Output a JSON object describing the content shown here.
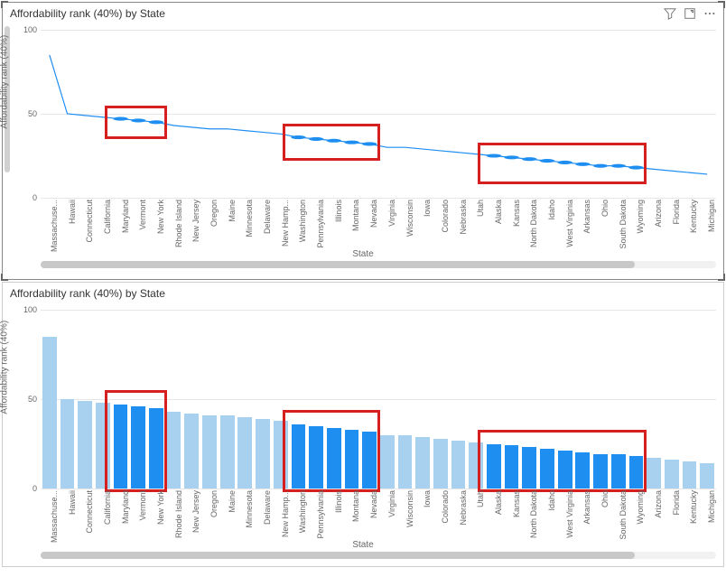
{
  "panel1": {
    "title": "Affordability rank (40%) by State",
    "ylabel": "Affordability rank (40%)",
    "xlabel": "State"
  },
  "panel2": {
    "title": "Affordability rank (40%) by State",
    "ylabel": "Affordability rank (40%)",
    "xlabel": "State"
  },
  "yticks": [
    "0",
    "50",
    "100"
  ],
  "chart_data": [
    {
      "type": "line",
      "title": "Affordability rank (40%) by State",
      "ylabel": "Affordability rank (40%)",
      "xlabel": "State",
      "ylim": [
        0,
        100
      ],
      "categories": [
        "Massachuse...",
        "Hawaii",
        "Connecticut",
        "California",
        "Maryland",
        "Vermont",
        "New York",
        "Rhode Island",
        "New Jersey",
        "Oregon",
        "Maine",
        "Minnesota",
        "Delaware",
        "New Hamp...",
        "Washington",
        "Pennsylvania",
        "Illinois",
        "Montana",
        "Nevada",
        "Virginia",
        "Wisconsin",
        "Iowa",
        "Colorado",
        "Nebraska",
        "Utah",
        "Alaska",
        "Kansas",
        "North Dakota",
        "Idaho",
        "West Virginia",
        "Arkansas",
        "Ohio",
        "South Dakota",
        "Wyoming",
        "Arizona",
        "Florida",
        "Kentucky",
        "Michigan"
      ],
      "values": [
        85,
        50,
        49,
        48,
        47,
        46,
        45,
        43,
        42,
        41,
        41,
        40,
        39,
        38,
        36,
        35,
        34,
        33,
        32,
        30,
        30,
        29,
        28,
        27,
        26,
        25,
        24,
        23,
        22,
        21,
        20,
        19,
        19,
        18,
        17,
        16,
        15,
        14
      ],
      "highlight_groups": [
        {
          "start_index": 4,
          "end_index": 6
        },
        {
          "start_index": 14,
          "end_index": 18
        },
        {
          "start_index": 25,
          "end_index": 33
        }
      ]
    },
    {
      "type": "bar",
      "title": "Affordability rank (40%) by State",
      "ylabel": "Affordability rank (40%)",
      "xlabel": "State",
      "ylim": [
        0,
        100
      ],
      "categories": [
        "Massachuse...",
        "Hawaii",
        "Connecticut",
        "California",
        "Maryland",
        "Vermont",
        "New York",
        "Rhode Island",
        "New Jersey",
        "Oregon",
        "Maine",
        "Minnesota",
        "Delaware",
        "New Hamp...",
        "Washington",
        "Pennsylvania",
        "Illinois",
        "Montana",
        "Nevada",
        "Virginia",
        "Wisconsin",
        "Iowa",
        "Colorado",
        "Nebraska",
        "Utah",
        "Alaska",
        "Kansas",
        "North Dakota",
        "Idaho",
        "West Virginia",
        "Arkansas",
        "Ohio",
        "South Dakota",
        "Wyoming",
        "Arizona",
        "Florida",
        "Kentucky",
        "Michigan"
      ],
      "values": [
        85,
        50,
        49,
        48,
        47,
        46,
        45,
        43,
        42,
        41,
        41,
        40,
        39,
        38,
        36,
        35,
        34,
        33,
        32,
        30,
        30,
        29,
        28,
        27,
        26,
        25,
        24,
        23,
        22,
        21,
        20,
        19,
        19,
        18,
        17,
        16,
        15,
        14
      ],
      "highlight_groups": [
        {
          "start_index": 4,
          "end_index": 6
        },
        {
          "start_index": 14,
          "end_index": 18
        },
        {
          "start_index": 25,
          "end_index": 33
        }
      ]
    }
  ]
}
